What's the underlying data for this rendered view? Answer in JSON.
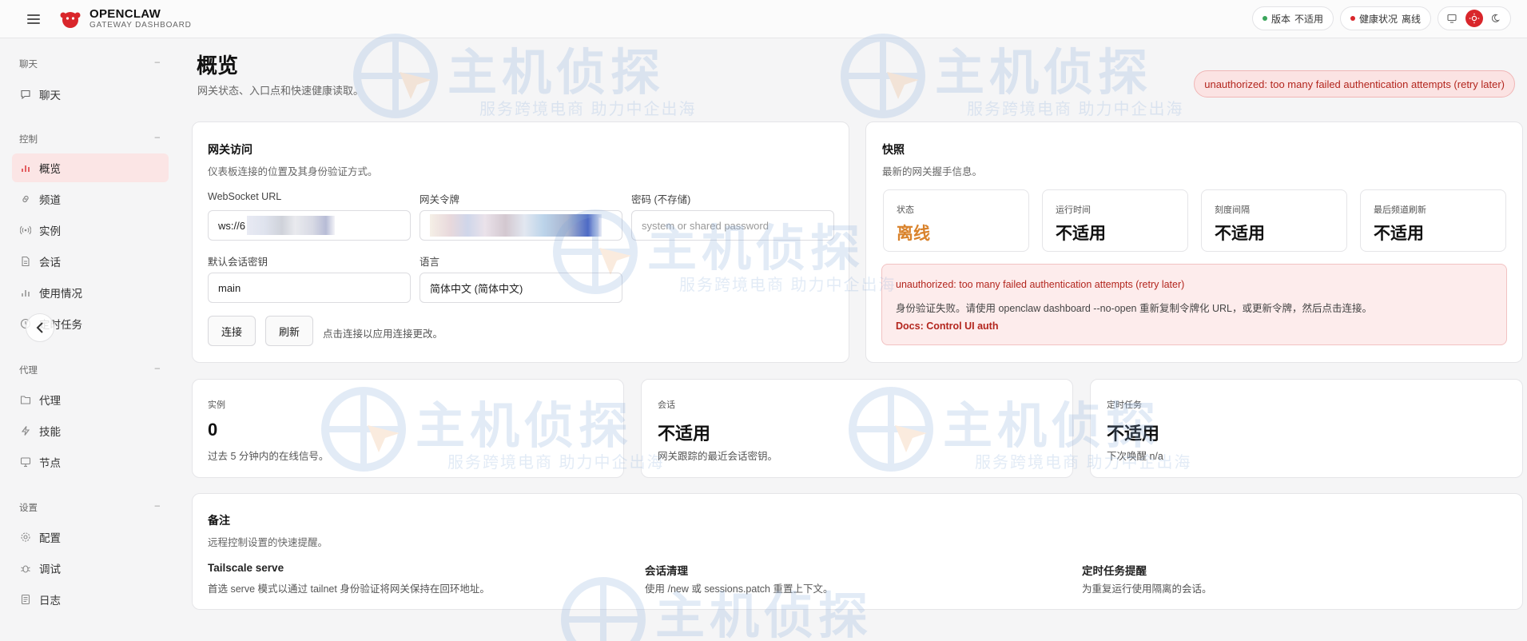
{
  "brand": {
    "name": "OPENCLAW",
    "subtitle": "GATEWAY DASHBOARD"
  },
  "topbar": {
    "version_label": "版本",
    "version_value": "不适用",
    "health_label": "健康状况",
    "health_value": "离线",
    "colors": {
      "version_dot": "#3aa55b",
      "health_dot": "#d9262b",
      "accent": "#d9262b"
    }
  },
  "sidebar": {
    "sections": [
      {
        "label": "聊天",
        "items": [
          {
            "label": "聊天",
            "icon": "chat-icon"
          }
        ]
      },
      {
        "label": "控制",
        "items": [
          {
            "label": "概览",
            "icon": "bar-chart-icon",
            "active": true
          },
          {
            "label": "频道",
            "icon": "link-icon"
          },
          {
            "label": "实例",
            "icon": "broadcast-icon"
          },
          {
            "label": "会话",
            "icon": "file-icon"
          },
          {
            "label": "使用情况",
            "icon": "bar-chart-icon"
          },
          {
            "label": "定时任务",
            "icon": "clock-icon"
          }
        ]
      },
      {
        "label": "代理",
        "items": [
          {
            "label": "代理",
            "icon": "folder-icon"
          },
          {
            "label": "技能",
            "icon": "bolt-icon"
          },
          {
            "label": "节点",
            "icon": "monitor-icon"
          }
        ]
      },
      {
        "label": "设置",
        "items": [
          {
            "label": "配置",
            "icon": "gear-icon"
          },
          {
            "label": "调试",
            "icon": "bug-icon"
          },
          {
            "label": "日志",
            "icon": "log-icon"
          }
        ]
      }
    ],
    "collapse_symbol": "–"
  },
  "page": {
    "title": "概览",
    "subtitle": "网关状态、入口点和快速健康读取。",
    "alert": "unauthorized: too many failed authentication attempts (retry later)"
  },
  "gateway": {
    "title": "网关访问",
    "subtitle": "仪表板连接的位置及其身份验证方式。",
    "ws_label": "WebSocket URL",
    "ws_value": "ws://6",
    "token_label": "网关令牌",
    "password_label": "密码 (不存储)",
    "password_placeholder": "system or shared password",
    "session_label": "默认会话密钥",
    "session_value": "main",
    "lang_label": "语言",
    "lang_value": "简体中文 (简体中文)",
    "connect_btn": "连接",
    "refresh_btn": "刷新",
    "hint": "点击连接以应用连接更改。"
  },
  "snapshot": {
    "title": "快照",
    "subtitle": "最新的网关握手信息。",
    "stats": [
      {
        "label": "状态",
        "value": "离线",
        "warn": true
      },
      {
        "label": "运行时间",
        "value": "不适用"
      },
      {
        "label": "刻度间隔",
        "value": "不适用"
      },
      {
        "label": "最后频道刷新",
        "value": "不适用"
      }
    ],
    "error_title": "unauthorized: too many failed authentication attempts (retry later)",
    "error_desc": "身份验证失败。请使用 openclaw dashboard --no-open 重新复制令牌化 URL，或更新令牌，然后点击连接。",
    "error_link": "Docs: Control UI auth"
  },
  "minis": [
    {
      "label": "实例",
      "value": "0",
      "desc": "过去 5 分钟内的在线信号。"
    },
    {
      "label": "会话",
      "value": "不适用",
      "desc": "网关跟踪的最近会话密钥。"
    },
    {
      "label": "定时任务",
      "value": "不适用",
      "desc": "下次唤醒 n/a"
    }
  ],
  "notes": {
    "title": "备注",
    "subtitle": "远程控制设置的快速提醒。",
    "items": [
      {
        "title": "Tailscale serve",
        "desc": "首选 serve 模式以通过 tailnet 身份验证将网关保持在回环地址。"
      },
      {
        "title": "会话清理",
        "desc": "使用 /new 或 sessions.patch 重置上下文。"
      },
      {
        "title": "定时任务提醒",
        "desc": "为重复运行使用隔离的会话。"
      }
    ]
  },
  "watermark": {
    "text": "主机侦探",
    "slogan": "服务跨境电商 助力中企出海"
  }
}
